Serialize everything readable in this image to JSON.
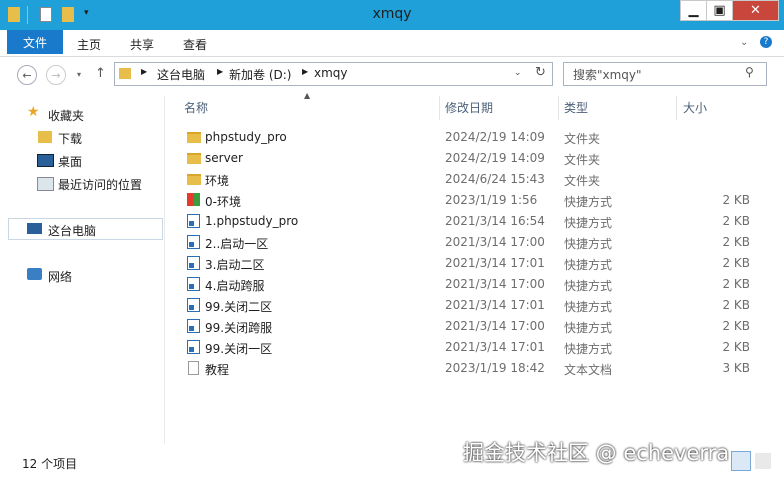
{
  "window": {
    "title": "xmqy"
  },
  "ribbon": {
    "tabs": [
      "文件",
      "主页",
      "共享",
      "查看"
    ]
  },
  "address": {
    "path": [
      "这台电脑",
      "新加卷 (D:)",
      "xmqy"
    ]
  },
  "search": {
    "placeholder": "搜索\"xmqy\""
  },
  "sidebar": {
    "items": [
      {
        "label": "收藏夹",
        "icon": "star-icon"
      },
      {
        "label": "下载",
        "icon": "download-folder-icon"
      },
      {
        "label": "桌面",
        "icon": "desktop-icon"
      },
      {
        "label": "最近访问的位置",
        "icon": "recent-places-icon"
      },
      {
        "label": "这台电脑",
        "icon": "computer-icon"
      },
      {
        "label": "网络",
        "icon": "network-icon"
      }
    ]
  },
  "columns": [
    "名称",
    "修改日期",
    "类型",
    "大小"
  ],
  "files": [
    {
      "name": "phpstudy_pro",
      "date": "2024/2/19 14:09",
      "type": "文件夹",
      "size": "",
      "icon": "folder"
    },
    {
      "name": "server",
      "date": "2024/2/19 14:09",
      "type": "文件夹",
      "size": "",
      "icon": "folder"
    },
    {
      "name": "环境",
      "date": "2024/6/24 15:43",
      "type": "文件夹",
      "size": "",
      "icon": "folder"
    },
    {
      "name": "0-环境",
      "date": "2023/1/19 1:56",
      "type": "快捷方式",
      "size": "2 KB",
      "icon": "colorful"
    },
    {
      "name": "1.phpstudy_pro",
      "date": "2021/3/14 16:54",
      "type": "快捷方式",
      "size": "2 KB",
      "icon": "shortcut"
    },
    {
      "name": "2..启动一区",
      "date": "2021/3/14 17:00",
      "type": "快捷方式",
      "size": "2 KB",
      "icon": "shortcut"
    },
    {
      "name": "3.启动二区",
      "date": "2021/3/14 17:01",
      "type": "快捷方式",
      "size": "2 KB",
      "icon": "shortcut"
    },
    {
      "name": "4.启动跨服",
      "date": "2021/3/14 17:00",
      "type": "快捷方式",
      "size": "2 KB",
      "icon": "shortcut"
    },
    {
      "name": "99.关闭二区",
      "date": "2021/3/14 17:01",
      "type": "快捷方式",
      "size": "2 KB",
      "icon": "shortcut"
    },
    {
      "name": "99.关闭跨服",
      "date": "2021/3/14 17:00",
      "type": "快捷方式",
      "size": "2 KB",
      "icon": "shortcut"
    },
    {
      "name": "99.关闭一区",
      "date": "2021/3/14 17:01",
      "type": "快捷方式",
      "size": "2 KB",
      "icon": "shortcut"
    },
    {
      "name": "教程",
      "date": "2023/1/19 18:42",
      "type": "文本文档",
      "size": "3 KB",
      "icon": "doc"
    }
  ],
  "status": {
    "count": "12 个项目"
  },
  "watermark": "掘金技术社区 @ echeverra",
  "colors": {
    "titlebar": "#1fa0d8",
    "file_tab": "#1979ca"
  }
}
